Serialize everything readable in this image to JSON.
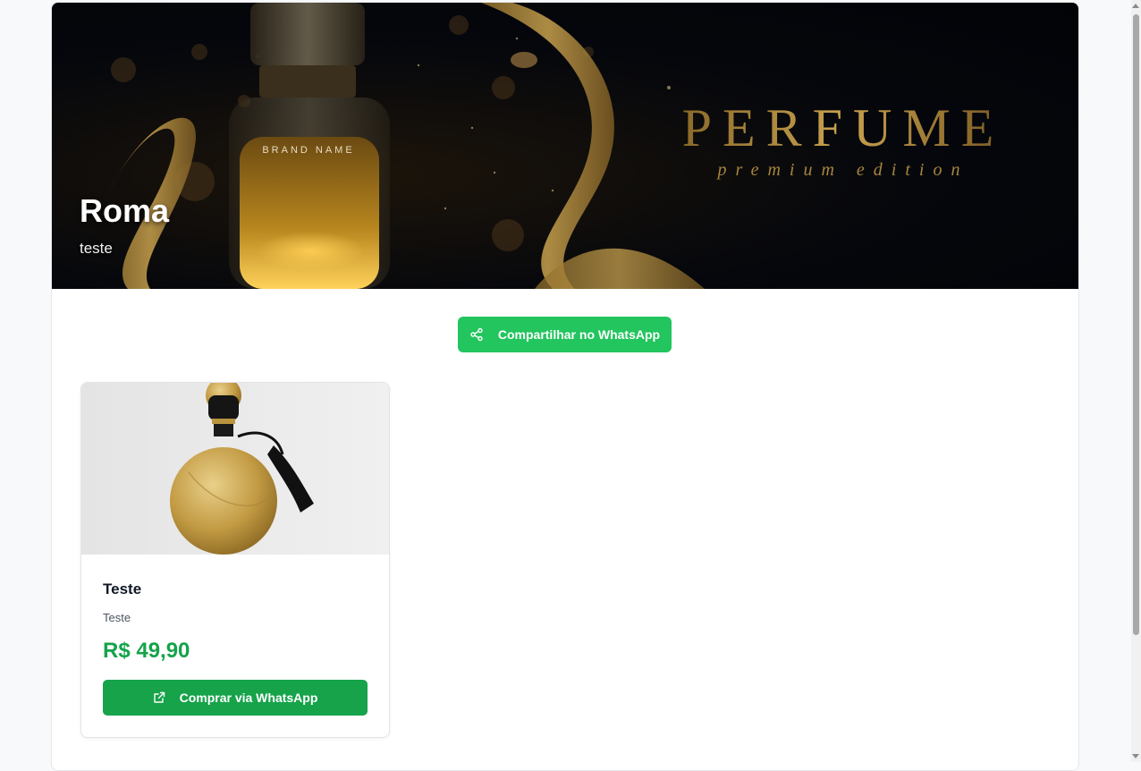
{
  "store": {
    "name": "Roma",
    "description": "teste"
  },
  "banner": {
    "headline": "PERFUME",
    "tagline": "premium edition",
    "bottle_label": "BRAND NAME"
  },
  "share_button": {
    "label": "Compartilhar no WhatsApp",
    "icon": "share-icon"
  },
  "products": [
    {
      "name": "Teste",
      "description": "Teste",
      "price": "R$ 49,90",
      "button_label": "Comprar via WhatsApp",
      "button_icon": "external-link-icon"
    }
  ],
  "colors": {
    "share_button": "#22c55e",
    "buy_button": "#16a34a",
    "price": "#16a34a",
    "banner_gold": "#b08a3a"
  }
}
